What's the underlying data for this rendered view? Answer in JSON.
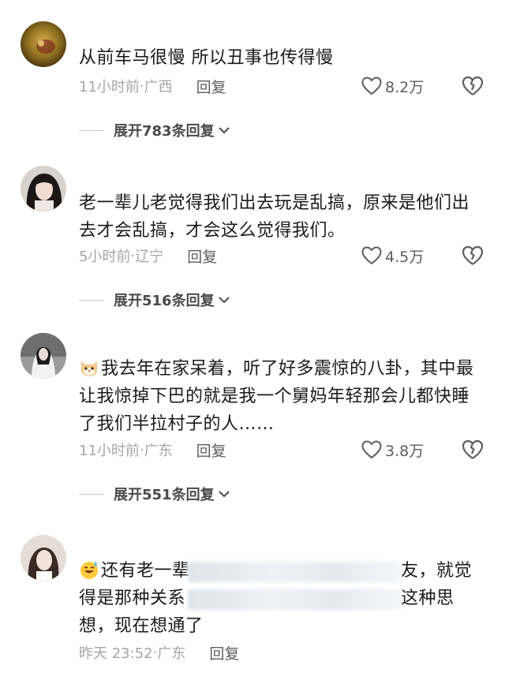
{
  "comments": [
    {
      "text": "从前车马很慢 所以丑事也传得慢",
      "time": "11小时前",
      "location": "广西",
      "reply_label": "回复",
      "likes": "8.2万",
      "expand": "展开783条回复"
    },
    {
      "text": "老一辈儿老觉得我们出去玩是乱搞，原来是他们出去才会乱搞，才会这么觉得我们。",
      "time": "5小时前",
      "location": "辽宁",
      "reply_label": "回复",
      "likes": "4.5万",
      "expand": "展开516条回复"
    },
    {
      "text": "我去年在家呆着，听了好多震惊的八卦，其中最让我惊掉下巴的就是我一个舅妈年轻那会儿都快睡了我们半拉村子的人……",
      "emoji": "cat-face-icon",
      "time": "11小时前",
      "location": "广东",
      "reply_label": "回复",
      "likes": "3.8万",
      "expand": "展开551条回复"
    },
    {
      "text_line1_a": "还有老一辈",
      "text_line1_b": "友，就觉",
      "text_line2_a": "得是那种关系",
      "text_line2_b": "这种思",
      "text_line3": "想，现在想通了",
      "emoji": "sweat-smile-icon",
      "time": "昨天 23:52",
      "location": "广东",
      "reply_label": "回复"
    }
  ],
  "colors": {
    "text": "#1a1a1a",
    "meta": "#a6a6a6",
    "action": "#5e5e5e"
  }
}
